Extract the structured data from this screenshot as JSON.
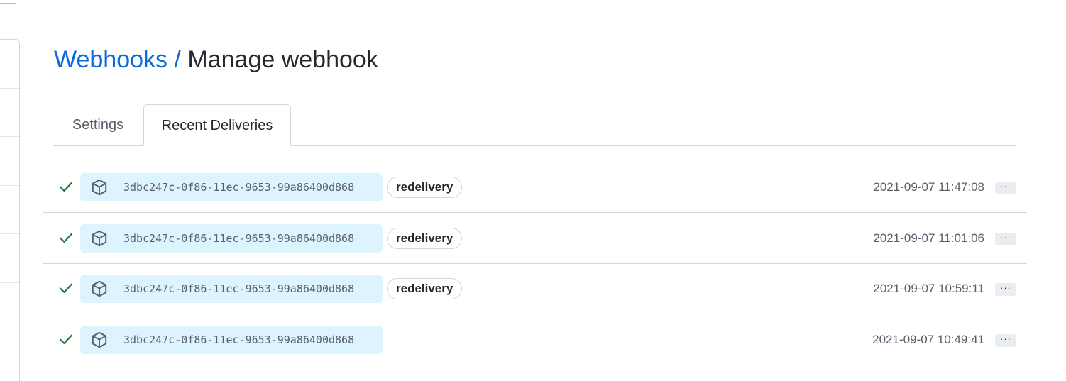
{
  "breadcrumb": {
    "parent": "Webhooks",
    "separator": "/",
    "current": "Manage webhook"
  },
  "tabs": [
    {
      "label": "Settings",
      "selected": false
    },
    {
      "label": "Recent Deliveries",
      "selected": true
    }
  ],
  "deliveries": [
    {
      "status_icon": "check-icon",
      "event_icon": "package-icon",
      "guid": "3dbc247c-0f86-11ec-9653-99a86400d868",
      "label": "redelivery",
      "time": "2021-09-07 11:47:08",
      "menu": "···"
    },
    {
      "status_icon": "check-icon",
      "event_icon": "package-icon",
      "guid": "3dbc247c-0f86-11ec-9653-99a86400d868",
      "label": "redelivery",
      "time": "2021-09-07 11:01:06",
      "menu": "···"
    },
    {
      "status_icon": "check-icon",
      "event_icon": "package-icon",
      "guid": "3dbc247c-0f86-11ec-9653-99a86400d868",
      "label": "redelivery",
      "time": "2021-09-07 10:59:11",
      "menu": "···"
    },
    {
      "status_icon": "check-icon",
      "event_icon": "package-icon",
      "guid": "3dbc247c-0f86-11ec-9653-99a86400d868",
      "label": "",
      "time": "2021-09-07 10:49:41",
      "menu": "···"
    }
  ],
  "colors": {
    "link": "#0969da",
    "success": "#1a7f37",
    "guid_background": "#ddf4ff"
  }
}
